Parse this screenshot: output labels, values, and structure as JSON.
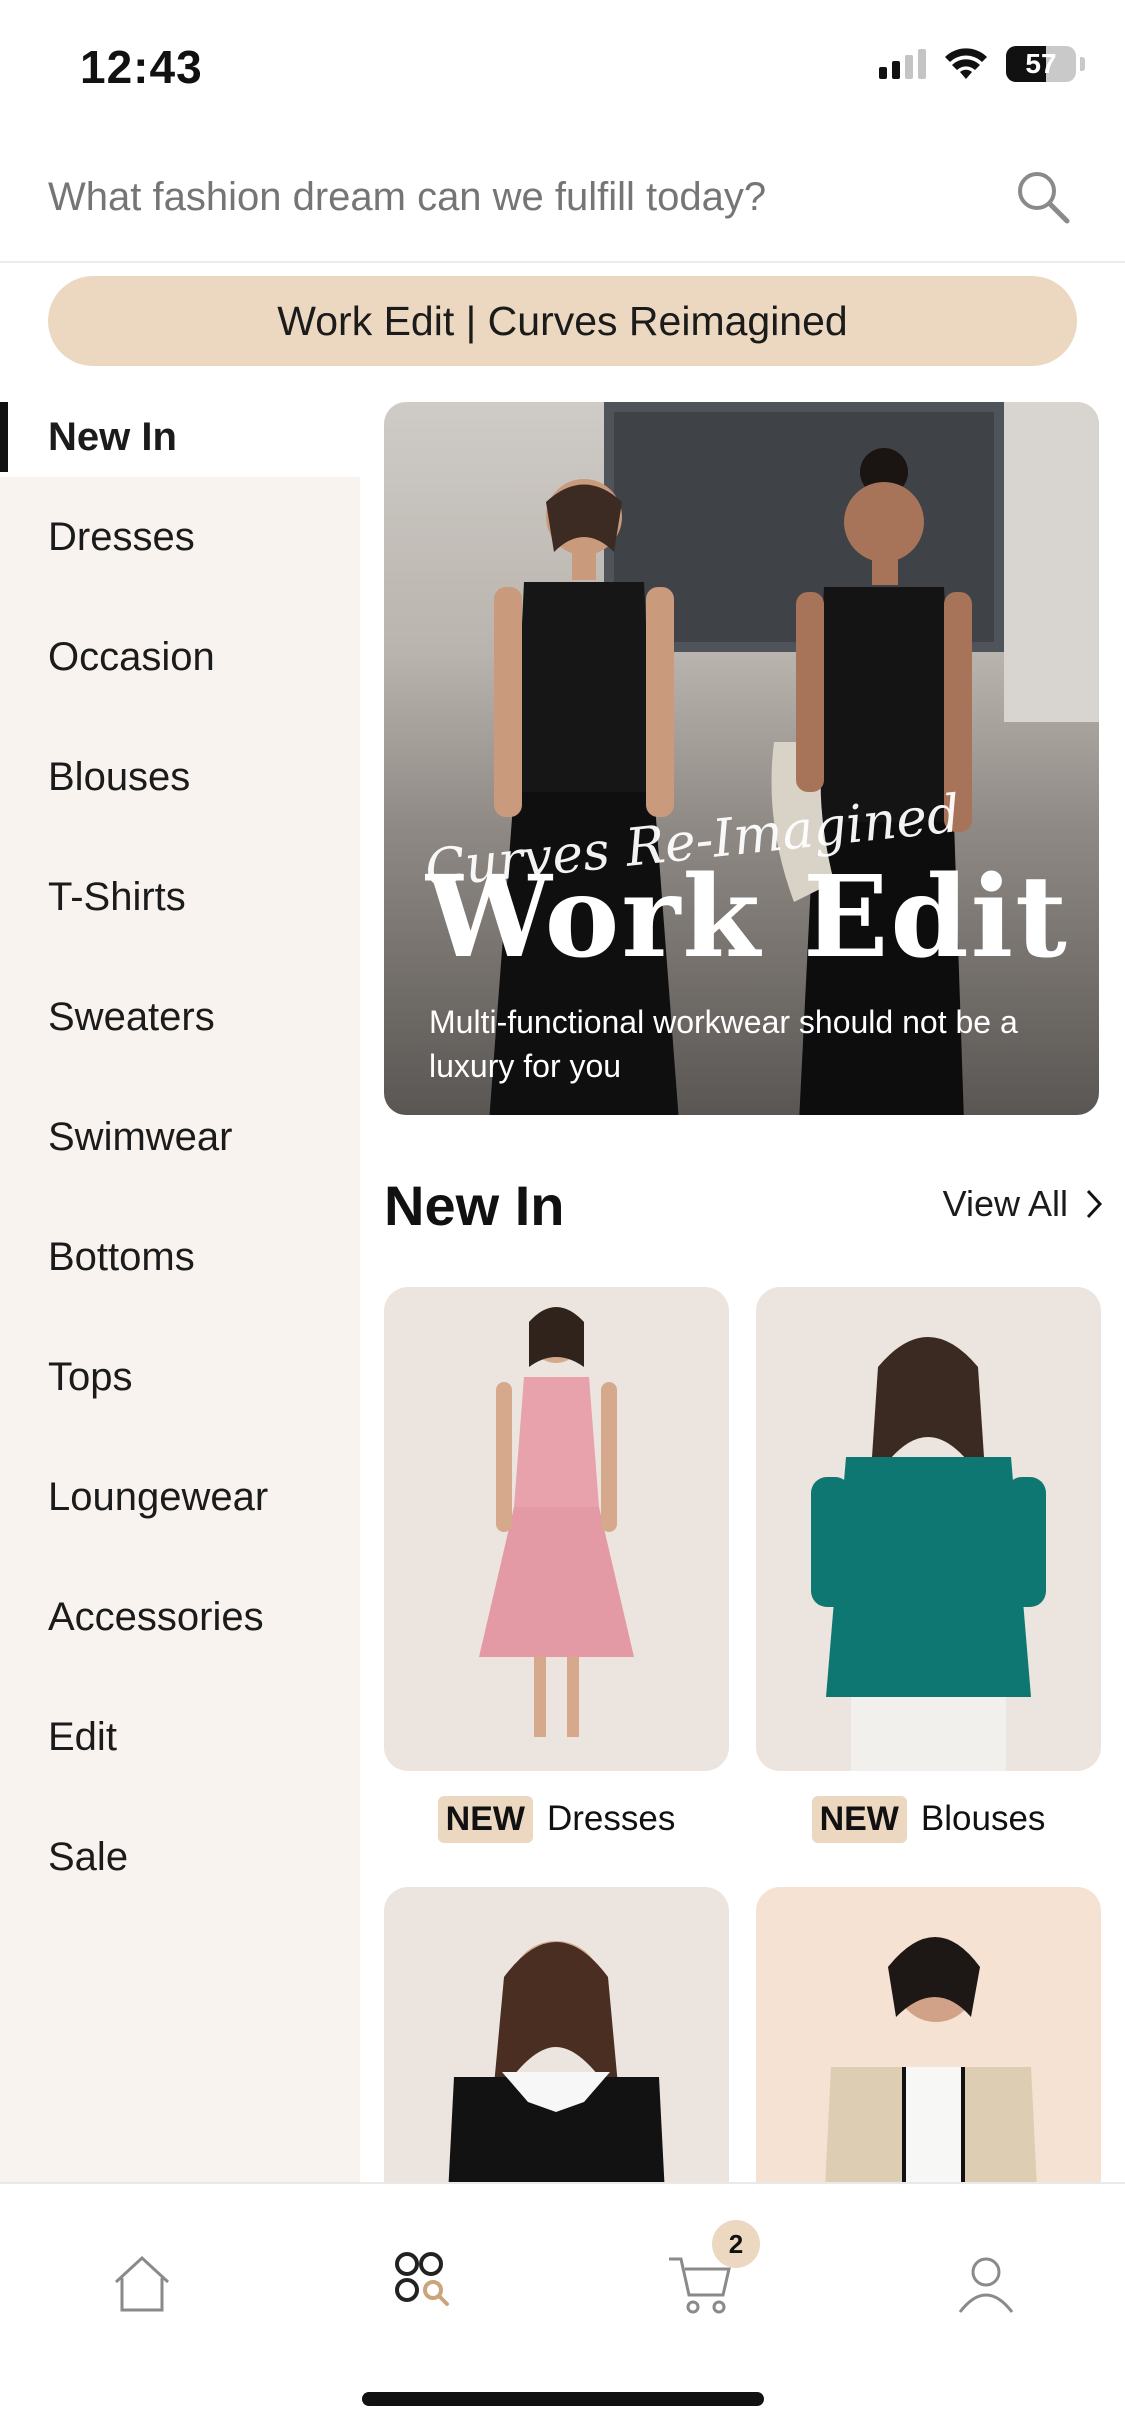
{
  "status_bar": {
    "time": "12:43",
    "battery": "57",
    "battery_level": 0.57
  },
  "search": {
    "placeholder": "What fashion dream can we fulfill today?"
  },
  "promo": {
    "label": "Work Edit | Curves Reimagined"
  },
  "sidebar": {
    "items": [
      {
        "label": "New In",
        "active": true
      },
      {
        "label": "Dresses"
      },
      {
        "label": "Occasion"
      },
      {
        "label": "Blouses"
      },
      {
        "label": "T-Shirts"
      },
      {
        "label": "Sweaters"
      },
      {
        "label": "Swimwear"
      },
      {
        "label": "Bottoms"
      },
      {
        "label": "Tops"
      },
      {
        "label": "Loungewear"
      },
      {
        "label": "Accessories"
      },
      {
        "label": "Edit"
      },
      {
        "label": "Sale"
      }
    ]
  },
  "hero": {
    "script": "Curves Re-Imagined",
    "title": "Work Edit",
    "subtitle": "Multi-functional workwear should not be a luxury for you"
  },
  "section": {
    "title": "New In",
    "view_all": "View All"
  },
  "products": [
    {
      "badge": "NEW",
      "category": "Dresses"
    },
    {
      "badge": "NEW",
      "category": "Blouses"
    },
    {
      "badge": "",
      "category": ""
    },
    {
      "badge": "",
      "category": ""
    }
  ],
  "tab_bar": {
    "tabs": [
      "home-icon",
      "category-icon",
      "cart-icon",
      "profile-icon"
    ],
    "cart_count": "2"
  },
  "colors": {
    "accent": "#ecd8c0",
    "sidebar_bg": "#f8f3ee",
    "product_bg": "#ece4df"
  }
}
